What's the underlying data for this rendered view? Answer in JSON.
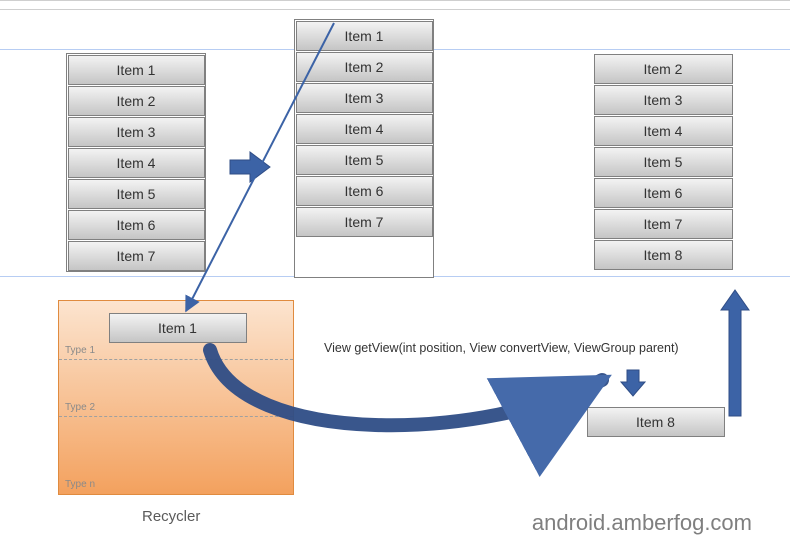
{
  "diagram": {
    "columns": {
      "before": {
        "items": [
          "Item 1",
          "Item 2",
          "Item 3",
          "Item 4",
          "Item 5",
          "Item 6",
          "Item 7"
        ]
      },
      "scrolled": {
        "items": [
          "Item 1",
          "Item 2",
          "Item 3",
          "Item 4",
          "Item 5",
          "Item 6",
          "Item 7"
        ]
      },
      "after": {
        "items": [
          "Item 2",
          "Item 3",
          "Item 4",
          "Item 5",
          "Item 6",
          "Item 7",
          "Item 8"
        ]
      }
    },
    "recycler": {
      "caption": "Recycler",
      "types": [
        "Type 1",
        "Type 2",
        "Type n"
      ],
      "recycled_item": "Item 1"
    },
    "new_item": "Item 8",
    "method_signature": "View getView(int position, View convertView, ViewGroup parent)",
    "brand": "android.amberfog.com"
  }
}
